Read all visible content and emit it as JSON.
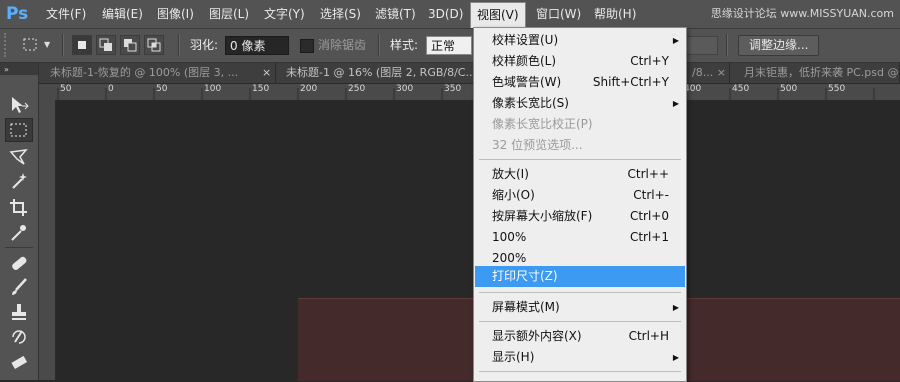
{
  "app": {
    "logo": "Ps",
    "watermark": "思缘设计论坛 www.MISSYUAN.com"
  },
  "menubar": {
    "items": [
      "文件(F)",
      "编辑(E)",
      "图像(I)",
      "图层(L)",
      "文字(Y)",
      "选择(S)",
      "滤镜(T)",
      "3D(D)",
      "视图(V)",
      "窗口(W)",
      "帮助(H)"
    ],
    "active": "视图(V)"
  },
  "options": {
    "feather_label": "羽化:",
    "feather_value": "0 像素",
    "antialias_label": "消除锯齿",
    "style_label": "样式:",
    "style_value": "正常",
    "refine_button": "调整边缘..."
  },
  "tabs": [
    {
      "label": "未标题-1-恢复的 @ 100% (图层 3, ...",
      "close": "×"
    },
    {
      "label": "未标题-1 @ 16% (图层 2, RGB/8/C...",
      "close": "×"
    },
    {
      "label": "/8... ×",
      "close": ""
    },
    {
      "label": "月末钜惠，低折来袭 PC.psd @",
      "close": "×"
    }
  ],
  "ruler": {
    "labels": [
      "50",
      "0",
      "50",
      "100",
      "150",
      "200",
      "250",
      "300",
      "350",
      "400",
      "450",
      "500",
      "550"
    ]
  },
  "view_menu": {
    "items": [
      {
        "label": "校样设置(U)",
        "shortcut": "",
        "submenu": true,
        "disabled": false
      },
      {
        "label": "校样颜色(L)",
        "shortcut": "Ctrl+Y",
        "submenu": false,
        "disabled": false
      },
      {
        "label": "色域警告(W)",
        "shortcut": "Shift+Ctrl+Y",
        "submenu": false,
        "disabled": false
      },
      {
        "label": "像素长宽比(S)",
        "shortcut": "",
        "submenu": true,
        "disabled": false
      },
      {
        "label": "像素长宽比校正(P)",
        "shortcut": "",
        "submenu": false,
        "disabled": true
      },
      {
        "label": "32 位预览选项...",
        "shortcut": "",
        "submenu": false,
        "disabled": true
      },
      {
        "label": "放大(I)",
        "shortcut": "Ctrl++",
        "submenu": false,
        "disabled": false
      },
      {
        "label": "缩小(O)",
        "shortcut": "Ctrl+-",
        "submenu": false,
        "disabled": false
      },
      {
        "label": "按屏幕大小缩放(F)",
        "shortcut": "Ctrl+0",
        "submenu": false,
        "disabled": false
      },
      {
        "label": "100%",
        "shortcut": "Ctrl+1",
        "submenu": false,
        "disabled": false
      },
      {
        "label": "200%",
        "shortcut": "",
        "submenu": false,
        "disabled": false
      },
      {
        "label": "打印尺寸(Z)",
        "shortcut": "",
        "submenu": false,
        "disabled": false,
        "highlighted": true
      },
      {
        "label": "屏幕模式(M)",
        "shortcut": "",
        "submenu": true,
        "disabled": false
      },
      {
        "label": "显示额外内容(X)",
        "shortcut": "Ctrl+H",
        "submenu": false,
        "disabled": false
      },
      {
        "label": "显示(H)",
        "shortcut": "",
        "submenu": true,
        "disabled": false
      }
    ],
    "submenu_arrow": "▶"
  },
  "colors": {
    "highlight": "#3c9af2",
    "canvas": "#452a2b",
    "ps_blue": "#5ab0ff"
  }
}
